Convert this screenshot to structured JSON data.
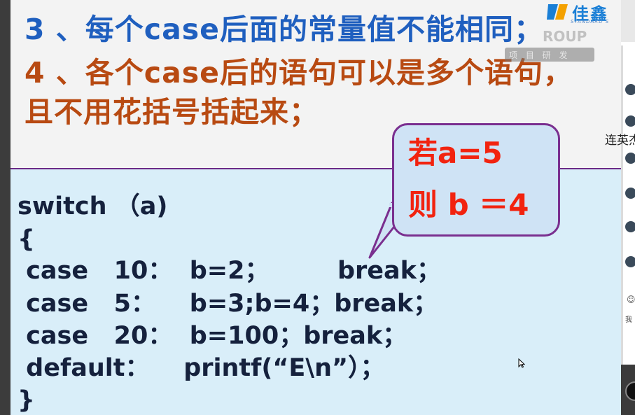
{
  "slide": {
    "heading_line1": "3 、每个case后面的常量值不能相同；",
    "heading_line2": "4 、各个case后的语句可以是多个语句，",
    "heading_line3": "且不用花括号括起来；"
  },
  "logo": {
    "brand_text": "佳鑫",
    "sub_text": "STANDARD S",
    "watermark_text": "ROUP",
    "watermark_bar_text": "项 目 研 发"
  },
  "callout": {
    "line1": "若a=5",
    "line2": "则 b ＝4"
  },
  "code": {
    "line1": "switch （a)",
    "line2": "{",
    "line3": " case   10：  b=2；        break；",
    "line4": " case   5：    b=3;b=4；break；",
    "line5": " case   20：  b=100；break；",
    "line6": " default：    printf(“E\\n”）；",
    "line7": "}"
  },
  "chat_panel": {
    "participant_name": "连英杰",
    "message_preview": "我"
  },
  "colors": {
    "heading_blue": "#1f5fbf",
    "heading_orange": "#b84a12",
    "code_bg": "#d9eef9",
    "callout_border": "#7a2f8f",
    "callout_text": "#f2230f",
    "code_text": "#15213d"
  }
}
